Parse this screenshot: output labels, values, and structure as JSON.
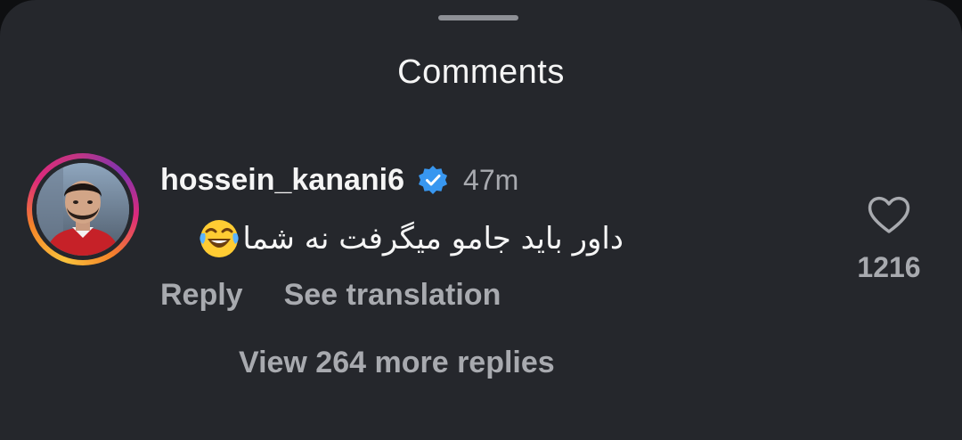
{
  "sheet": {
    "title": "Comments"
  },
  "comment": {
    "username": "hossein_kanani6",
    "verified": true,
    "timestamp": "47m",
    "text": "داور باید جامو میگرفت نه شما",
    "emoji": "laughing-with-tears-emoji",
    "reply_label": "Reply",
    "translate_label": "See translation",
    "like_count": "1216",
    "view_replies_label": "View 264 more replies"
  },
  "colors": {
    "background": "#25272c",
    "primary_text": "#f5f5f5",
    "secondary_text": "#a8aaaf",
    "verified_badge": "#3897f0"
  }
}
